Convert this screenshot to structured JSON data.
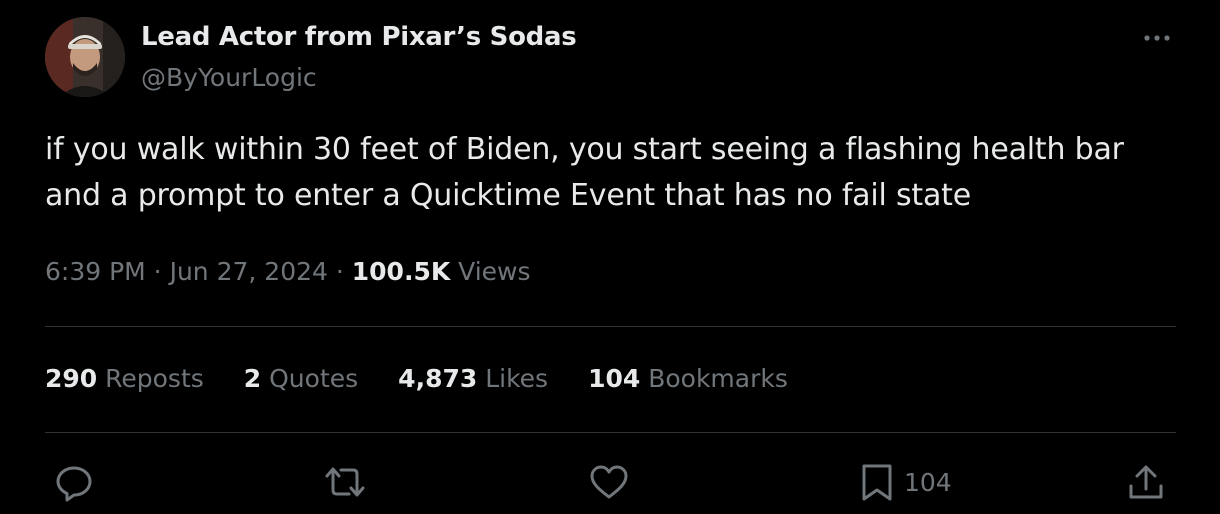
{
  "author": {
    "display_name": "Lead Actor from Pixar’s Sodas",
    "handle": "@ByYourLogic"
  },
  "tweet": {
    "text_line1": "if you walk within 30 feet of Biden, you start seeing a flashing health bar",
    "text_line2": "and a prompt to enter a Quicktime Event that has no fail state",
    "time": "6:39 PM",
    "sep1": " · ",
    "date": "Jun 27, 2024",
    "sep2": " · ",
    "views_count": "100.5K",
    "views_label": " Views"
  },
  "stats": {
    "reposts_count": "290",
    "reposts_label": " Reposts",
    "quotes_count": "2",
    "quotes_label": " Quotes",
    "likes_count": "4,873",
    "likes_label": " Likes",
    "bookmarks_count": "104",
    "bookmarks_label": " Bookmarks"
  },
  "actions": {
    "reply_icon": "reply-icon",
    "repost_icon": "repost-icon",
    "like_icon": "heart-icon",
    "bookmark_icon": "bookmark-icon",
    "bookmark_count": "104",
    "share_icon": "share-icon"
  },
  "colors": {
    "background": "#000000",
    "primary_text": "#e7e9ea",
    "secondary_text": "#71767b",
    "divider": "#2f3336"
  }
}
